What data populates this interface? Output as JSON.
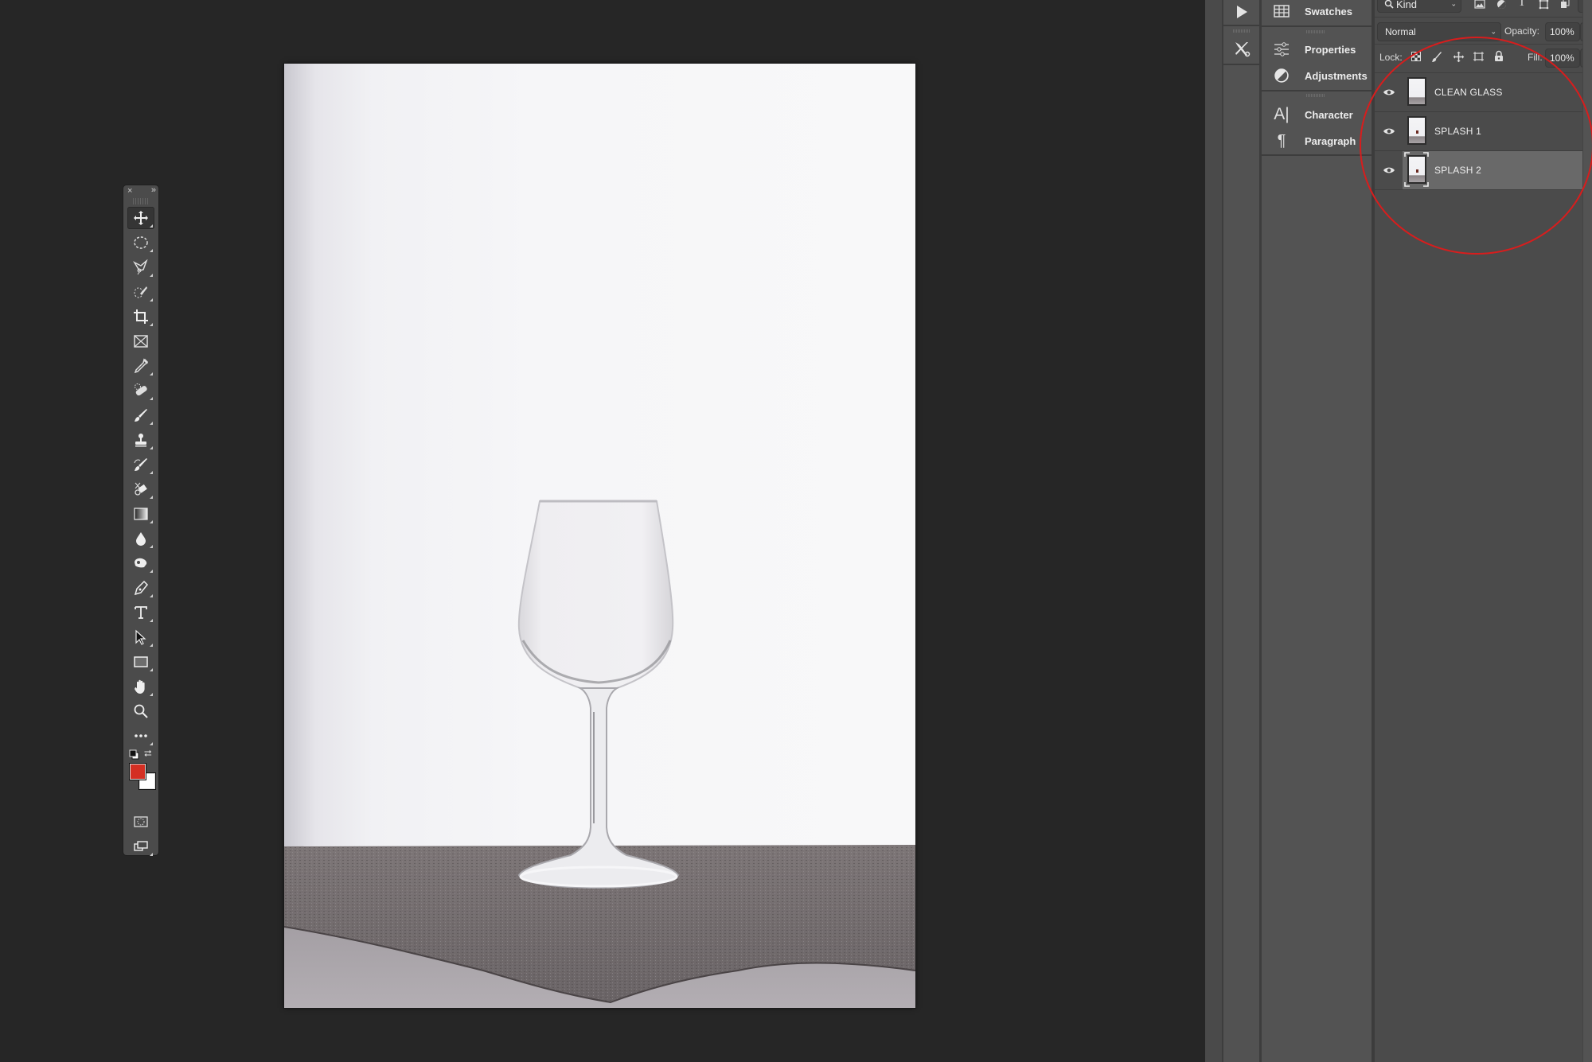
{
  "app": "Photoshop",
  "document": {
    "subject": "empty wine glass on textured table against white backdrop"
  },
  "tools": {
    "header": {
      "close": "×",
      "expand": "»"
    },
    "items": [
      {
        "id": "move",
        "name": "move-tool",
        "icon": "move-icon",
        "active": true
      },
      {
        "id": "marquee",
        "name": "elliptical-marquee-tool",
        "icon": "ellipse-marquee-icon"
      },
      {
        "id": "lasso",
        "name": "polygonal-lasso-tool",
        "icon": "polygon-lasso-icon"
      },
      {
        "id": "quick",
        "name": "quick-selection-tool",
        "icon": "quick-selection-icon"
      },
      {
        "id": "crop",
        "name": "crop-tool",
        "icon": "crop-icon"
      },
      {
        "id": "frame",
        "name": "frame-tool",
        "icon": "frame-icon"
      },
      {
        "id": "eyedropper",
        "name": "eyedropper-tool",
        "icon": "eyedropper-icon"
      },
      {
        "id": "heal",
        "name": "healing-brush-tool",
        "icon": "bandage-icon"
      },
      {
        "id": "brush",
        "name": "brush-tool",
        "icon": "brush-icon"
      },
      {
        "id": "stamp",
        "name": "clone-stamp-tool",
        "icon": "stamp-icon"
      },
      {
        "id": "history",
        "name": "history-brush-tool",
        "icon": "history-brush-icon"
      },
      {
        "id": "eraser",
        "name": "eraser-tool",
        "icon": "eraser-icon"
      },
      {
        "id": "gradient",
        "name": "gradient-tool",
        "icon": "gradient-icon"
      },
      {
        "id": "blur",
        "name": "blur-tool",
        "icon": "drop-icon"
      },
      {
        "id": "dodge",
        "name": "dodge-tool",
        "icon": "dodge-icon"
      },
      {
        "id": "pen",
        "name": "pen-tool",
        "icon": "pen-icon"
      },
      {
        "id": "type",
        "name": "type-tool",
        "icon": "type-icon"
      },
      {
        "id": "select",
        "name": "path-selection-tool",
        "icon": "arrow-icon"
      },
      {
        "id": "rect",
        "name": "rectangle-tool",
        "icon": "rectangle-icon"
      },
      {
        "id": "hand",
        "name": "hand-tool",
        "icon": "hand-icon"
      },
      {
        "id": "zoom",
        "name": "zoom-tool",
        "icon": "magnifier-icon"
      },
      {
        "id": "more",
        "name": "edit-toolbar",
        "icon": "more-icon"
      }
    ],
    "colors": {
      "foreground": "#d42f23",
      "background": "#ffffff"
    },
    "bottom": [
      {
        "name": "quick-mask-button",
        "icon": "quick-mask-icon"
      },
      {
        "name": "screen-mode-button",
        "icon": "screen-mode-icon"
      }
    ]
  },
  "dock": {
    "icon_column": [
      {
        "name": "actions-play-button",
        "icon": "play-icon"
      },
      {
        "name": "tool-presets-button",
        "icon": "tools-icon"
      }
    ],
    "panels": [
      {
        "label": "Swatches",
        "icon": "grid-icon"
      },
      {
        "label": "Properties",
        "icon": "sliders-icon"
      },
      {
        "label": "Adjustments",
        "icon": "adjust-circle-icon"
      },
      {
        "label": "Character",
        "icon": "character-icon"
      },
      {
        "label": "Paragraph",
        "icon": "pilcrow-icon"
      }
    ]
  },
  "layers_panel": {
    "filter": {
      "label": "Kind",
      "icons": [
        "image-filter-icon",
        "adjustment-filter-icon",
        "type-filter-icon",
        "shape-filter-icon",
        "smart-object-filter-icon"
      ]
    },
    "blend_mode": "Normal",
    "opacity_label": "Opacity:",
    "opacity": "100%",
    "lock_label": "Lock:",
    "lock_icons": [
      "lock-transparent-icon",
      "lock-paint-icon",
      "lock-position-icon",
      "lock-artboard-icon",
      "lock-all-icon"
    ],
    "fill_label": "Fill:",
    "fill": "100%",
    "layers": [
      {
        "name": "CLEAN GLASS",
        "visible": true,
        "selected": false
      },
      {
        "name": "SPLASH 1",
        "visible": true,
        "selected": false
      },
      {
        "name": "SPLASH 2",
        "visible": true,
        "selected": true
      }
    ]
  },
  "annotation": {
    "shape": "circle",
    "color": "#d81d1d",
    "target": "layers list"
  }
}
